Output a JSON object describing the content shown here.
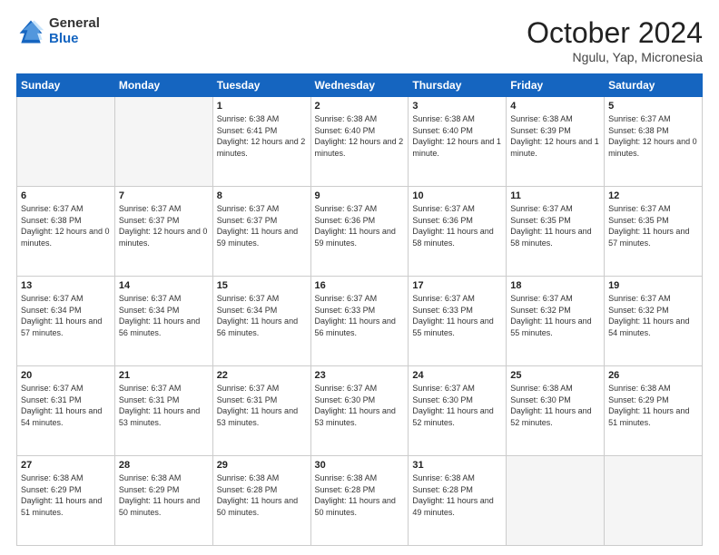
{
  "header": {
    "logo": {
      "general": "General",
      "blue": "Blue"
    },
    "title": "October 2024",
    "location": "Ngulu, Yap, Micronesia"
  },
  "days_of_week": [
    "Sunday",
    "Monday",
    "Tuesday",
    "Wednesday",
    "Thursday",
    "Friday",
    "Saturday"
  ],
  "weeks": [
    [
      {
        "day": "",
        "empty": true
      },
      {
        "day": "",
        "empty": true
      },
      {
        "day": "1",
        "sunrise": "Sunrise: 6:38 AM",
        "sunset": "Sunset: 6:41 PM",
        "daylight": "Daylight: 12 hours and 2 minutes."
      },
      {
        "day": "2",
        "sunrise": "Sunrise: 6:38 AM",
        "sunset": "Sunset: 6:40 PM",
        "daylight": "Daylight: 12 hours and 2 minutes."
      },
      {
        "day": "3",
        "sunrise": "Sunrise: 6:38 AM",
        "sunset": "Sunset: 6:40 PM",
        "daylight": "Daylight: 12 hours and 1 minute."
      },
      {
        "day": "4",
        "sunrise": "Sunrise: 6:38 AM",
        "sunset": "Sunset: 6:39 PM",
        "daylight": "Daylight: 12 hours and 1 minute."
      },
      {
        "day": "5",
        "sunrise": "Sunrise: 6:37 AM",
        "sunset": "Sunset: 6:38 PM",
        "daylight": "Daylight: 12 hours and 0 minutes."
      }
    ],
    [
      {
        "day": "6",
        "sunrise": "Sunrise: 6:37 AM",
        "sunset": "Sunset: 6:38 PM",
        "daylight": "Daylight: 12 hours and 0 minutes."
      },
      {
        "day": "7",
        "sunrise": "Sunrise: 6:37 AM",
        "sunset": "Sunset: 6:37 PM",
        "daylight": "Daylight: 12 hours and 0 minutes."
      },
      {
        "day": "8",
        "sunrise": "Sunrise: 6:37 AM",
        "sunset": "Sunset: 6:37 PM",
        "daylight": "Daylight: 11 hours and 59 minutes."
      },
      {
        "day": "9",
        "sunrise": "Sunrise: 6:37 AM",
        "sunset": "Sunset: 6:36 PM",
        "daylight": "Daylight: 11 hours and 59 minutes."
      },
      {
        "day": "10",
        "sunrise": "Sunrise: 6:37 AM",
        "sunset": "Sunset: 6:36 PM",
        "daylight": "Daylight: 11 hours and 58 minutes."
      },
      {
        "day": "11",
        "sunrise": "Sunrise: 6:37 AM",
        "sunset": "Sunset: 6:35 PM",
        "daylight": "Daylight: 11 hours and 58 minutes."
      },
      {
        "day": "12",
        "sunrise": "Sunrise: 6:37 AM",
        "sunset": "Sunset: 6:35 PM",
        "daylight": "Daylight: 11 hours and 57 minutes."
      }
    ],
    [
      {
        "day": "13",
        "sunrise": "Sunrise: 6:37 AM",
        "sunset": "Sunset: 6:34 PM",
        "daylight": "Daylight: 11 hours and 57 minutes."
      },
      {
        "day": "14",
        "sunrise": "Sunrise: 6:37 AM",
        "sunset": "Sunset: 6:34 PM",
        "daylight": "Daylight: 11 hours and 56 minutes."
      },
      {
        "day": "15",
        "sunrise": "Sunrise: 6:37 AM",
        "sunset": "Sunset: 6:34 PM",
        "daylight": "Daylight: 11 hours and 56 minutes."
      },
      {
        "day": "16",
        "sunrise": "Sunrise: 6:37 AM",
        "sunset": "Sunset: 6:33 PM",
        "daylight": "Daylight: 11 hours and 56 minutes."
      },
      {
        "day": "17",
        "sunrise": "Sunrise: 6:37 AM",
        "sunset": "Sunset: 6:33 PM",
        "daylight": "Daylight: 11 hours and 55 minutes."
      },
      {
        "day": "18",
        "sunrise": "Sunrise: 6:37 AM",
        "sunset": "Sunset: 6:32 PM",
        "daylight": "Daylight: 11 hours and 55 minutes."
      },
      {
        "day": "19",
        "sunrise": "Sunrise: 6:37 AM",
        "sunset": "Sunset: 6:32 PM",
        "daylight": "Daylight: 11 hours and 54 minutes."
      }
    ],
    [
      {
        "day": "20",
        "sunrise": "Sunrise: 6:37 AM",
        "sunset": "Sunset: 6:31 PM",
        "daylight": "Daylight: 11 hours and 54 minutes."
      },
      {
        "day": "21",
        "sunrise": "Sunrise: 6:37 AM",
        "sunset": "Sunset: 6:31 PM",
        "daylight": "Daylight: 11 hours and 53 minutes."
      },
      {
        "day": "22",
        "sunrise": "Sunrise: 6:37 AM",
        "sunset": "Sunset: 6:31 PM",
        "daylight": "Daylight: 11 hours and 53 minutes."
      },
      {
        "day": "23",
        "sunrise": "Sunrise: 6:37 AM",
        "sunset": "Sunset: 6:30 PM",
        "daylight": "Daylight: 11 hours and 53 minutes."
      },
      {
        "day": "24",
        "sunrise": "Sunrise: 6:37 AM",
        "sunset": "Sunset: 6:30 PM",
        "daylight": "Daylight: 11 hours and 52 minutes."
      },
      {
        "day": "25",
        "sunrise": "Sunrise: 6:38 AM",
        "sunset": "Sunset: 6:30 PM",
        "daylight": "Daylight: 11 hours and 52 minutes."
      },
      {
        "day": "26",
        "sunrise": "Sunrise: 6:38 AM",
        "sunset": "Sunset: 6:29 PM",
        "daylight": "Daylight: 11 hours and 51 minutes."
      }
    ],
    [
      {
        "day": "27",
        "sunrise": "Sunrise: 6:38 AM",
        "sunset": "Sunset: 6:29 PM",
        "daylight": "Daylight: 11 hours and 51 minutes."
      },
      {
        "day": "28",
        "sunrise": "Sunrise: 6:38 AM",
        "sunset": "Sunset: 6:29 PM",
        "daylight": "Daylight: 11 hours and 50 minutes."
      },
      {
        "day": "29",
        "sunrise": "Sunrise: 6:38 AM",
        "sunset": "Sunset: 6:28 PM",
        "daylight": "Daylight: 11 hours and 50 minutes."
      },
      {
        "day": "30",
        "sunrise": "Sunrise: 6:38 AM",
        "sunset": "Sunset: 6:28 PM",
        "daylight": "Daylight: 11 hours and 50 minutes."
      },
      {
        "day": "31",
        "sunrise": "Sunrise: 6:38 AM",
        "sunset": "Sunset: 6:28 PM",
        "daylight": "Daylight: 11 hours and 49 minutes."
      },
      {
        "day": "",
        "empty": true
      },
      {
        "day": "",
        "empty": true
      }
    ]
  ]
}
